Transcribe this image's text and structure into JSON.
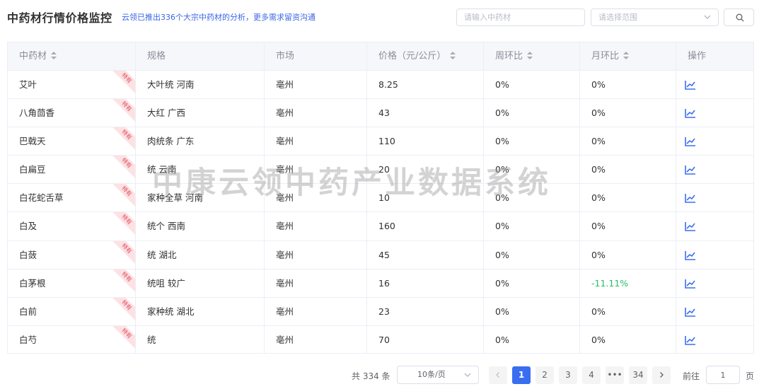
{
  "header": {
    "title": "中药材行情价格监控",
    "subtitle": "云领已推出336个大宗中药材的分析，更多需求留资沟通",
    "search_placeholder": "请输入中药材",
    "range_placeholder": "请选择范围",
    "search_icon": "search-icon",
    "chevron_icon": "chevron-down-icon"
  },
  "table": {
    "columns": [
      "中药材",
      "规格",
      "市场",
      "价格（元/公斤）",
      "周环比",
      "月环比",
      "操作"
    ],
    "ribbon_text": "特有",
    "action_icon": "trend-chart-icon",
    "rows": [
      {
        "herb": "艾叶",
        "spec": "大叶统 河南",
        "market": "亳州",
        "price": "8.25",
        "wow": "0%",
        "mom": "0%"
      },
      {
        "herb": "八角茴香",
        "spec": "大红 广西",
        "market": "亳州",
        "price": "43",
        "wow": "0%",
        "mom": "0%"
      },
      {
        "herb": "巴戟天",
        "spec": "肉统条 广东",
        "market": "亳州",
        "price": "110",
        "wow": "0%",
        "mom": "0%"
      },
      {
        "herb": "白扁豆",
        "spec": "统 云南",
        "market": "亳州",
        "price": "20",
        "wow": "0%",
        "mom": "0%"
      },
      {
        "herb": "白花蛇舌草",
        "spec": "家种全草 河南",
        "market": "亳州",
        "price": "10",
        "wow": "0%",
        "mom": "0%"
      },
      {
        "herb": "白及",
        "spec": "统个 西南",
        "market": "亳州",
        "price": "160",
        "wow": "0%",
        "mom": "0%"
      },
      {
        "herb": "白蔹",
        "spec": "统 湖北",
        "market": "亳州",
        "price": "45",
        "wow": "0%",
        "mom": "0%"
      },
      {
        "herb": "白茅根",
        "spec": "统咀 较广",
        "market": "亳州",
        "price": "16",
        "wow": "0%",
        "mom": "-11.11%"
      },
      {
        "herb": "白前",
        "spec": "家种统 湖北",
        "market": "亳州",
        "price": "23",
        "wow": "0%",
        "mom": "0%"
      },
      {
        "herb": "白芍",
        "spec": "统",
        "market": "亳州",
        "price": "70",
        "wow": "0%",
        "mom": "0%"
      }
    ]
  },
  "watermark": "中康云领中药产业数据系统",
  "pagination": {
    "total_text": "共 334 条",
    "page_size": "10条/页",
    "pages": [
      "1",
      "2",
      "3",
      "4",
      "•••",
      "34"
    ],
    "current_page": "1",
    "prev_icon": "chevron-left-icon",
    "next_icon": "chevron-right-icon",
    "goto_label": "前往",
    "goto_value": "1",
    "page_suffix": "页"
  },
  "colors": {
    "accent": "#3a6ef0",
    "negative": "#2bbd6b",
    "ribbon_bg": "#fde2e4",
    "ribbon_text": "#e24a5a"
  }
}
